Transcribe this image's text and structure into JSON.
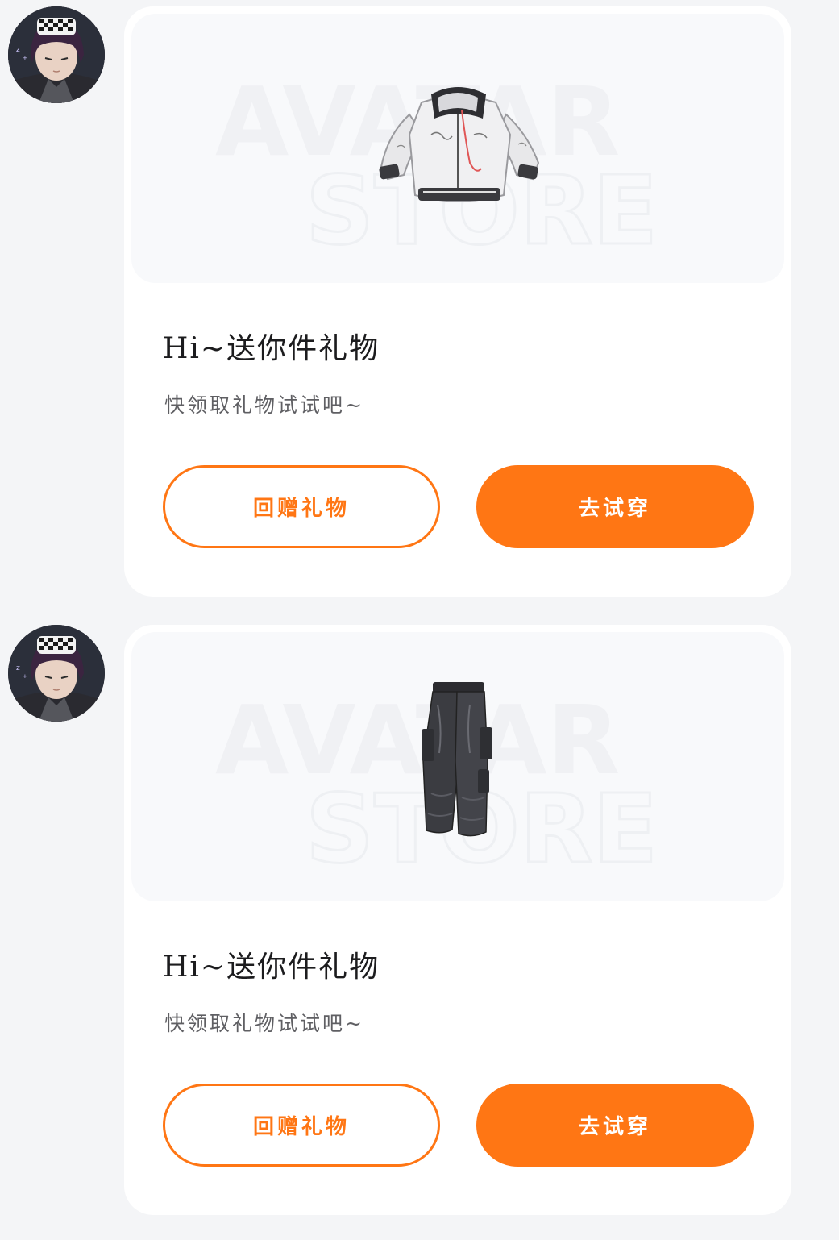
{
  "messages": [
    {
      "sender_avatar_icon": "user-avatar",
      "item_icon": "hoodie-jacket-icon",
      "watermark": {
        "line1": "AVATAR",
        "line2": "STORE"
      },
      "title": "Hi~送你件礼物",
      "subtitle": "快领取礼物试试吧~",
      "return_gift_label": "回赠礼物",
      "try_on_label": "去试穿"
    },
    {
      "sender_avatar_icon": "user-avatar",
      "item_icon": "cargo-pants-icon",
      "watermark": {
        "line1": "AVATAR",
        "line2": "STORE"
      },
      "title": "Hi~送你件礼物",
      "subtitle": "快领取礼物试试吧~",
      "return_gift_label": "回赠礼物",
      "try_on_label": "去试穿"
    }
  ],
  "colors": {
    "background": "#f4f5f7",
    "card": "#ffffff",
    "preview": "#f8f9fb",
    "accent": "#ff7614",
    "title": "#1c1c1e",
    "subtitle": "#5f5f63"
  }
}
